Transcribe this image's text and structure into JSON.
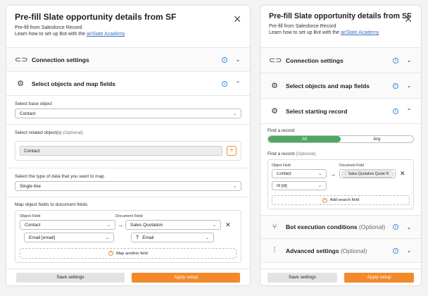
{
  "left": {
    "title": "Pre-fill Slate opportunity details from SF",
    "subtitle": "Pre-fill from Salesforce Record",
    "help_text": "Learn how to set up Bot with the ",
    "help_link": "airSlate Academy",
    "sections": {
      "connection": "Connection settings",
      "select_objects": "Select objects and map fields"
    },
    "base_object": {
      "label": "Select base object",
      "value": "Contact"
    },
    "related": {
      "label": "Select related object(s)",
      "optional": "(Optional)",
      "value": "Contact"
    },
    "data_type": {
      "label": "Select the type of data that you want to map",
      "value": "Single line"
    },
    "map": {
      "label": "Map object fields to document fields",
      "object_field_label": "Object Field",
      "document_field_label": "Document Field",
      "object_value": "Contact",
      "object_sub_value": "Email [email]",
      "document_value": "Sales Quotation",
      "document_sub_value": "Email",
      "add_label": "Map another field"
    },
    "footer": {
      "save": "Save settings",
      "apply": "Apply setup"
    }
  },
  "right": {
    "title": "Pre-fill Slate opportunity details from SF",
    "subtitle": "Pre-fill from Salesforce Record",
    "help_text": "Learn how to set up Bot with the ",
    "help_link": "airSlate Academy",
    "sections": {
      "connection": "Connection settings",
      "select_objects": "Select objects and map fields",
      "starting_record": "Select starting record",
      "execution": "Bot execution conditions",
      "execution_optional": "(Optional)",
      "advanced": "Advanced settings",
      "advanced_optional": "(Optional)"
    },
    "find_record": {
      "label": "Find a record",
      "toggle_all": "All",
      "toggle_any": "Any"
    },
    "find_record2": {
      "label": "Find a record",
      "optional": "(Optional)"
    },
    "lookup": {
      "object_field_label": "Object Field",
      "document_field_label": "Document Field",
      "object_value": "Contact",
      "object_sub_value": "Id [id]",
      "document_value": "Sales Quotation Quote N",
      "add_label": "Add search field"
    },
    "footer": {
      "save": "Save settings",
      "apply": "Apply setup"
    }
  },
  "colors": {
    "accent": "#f28a2c",
    "info": "#3c8de0",
    "toggle_on": "#4ea865"
  }
}
